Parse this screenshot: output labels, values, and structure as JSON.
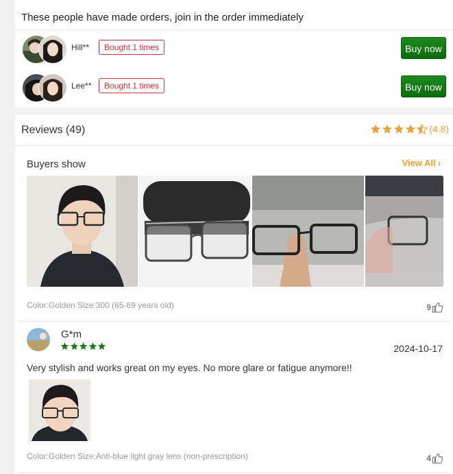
{
  "orders": {
    "title": "These people have made orders, join in the order immediately",
    "buyers": [
      {
        "name": "Hill**",
        "badge": "Bought 1 times",
        "button": "Buy now"
      },
      {
        "name": "Lee**",
        "badge": "Bought 1 times",
        "button": "Buy now"
      }
    ]
  },
  "reviews": {
    "title": "Reviews (49)",
    "rating_value": "(4.8)",
    "rating_stars": 4.5,
    "accent_color": "#e6a23c",
    "buyers_show": {
      "title": "Buyers show",
      "view_all": "View All",
      "meta": "Color:Golden Size:300 (65-69 years old)",
      "likes": "9"
    },
    "items": [
      {
        "user": "G*m",
        "stars": 5,
        "date": "2024-10-17",
        "text": "Very stylish and works great on my eyes. No more glare or fatigue anymore!!",
        "meta": "Color:Golden Size:Anti-blue light gray lens (non-prescription)",
        "likes": "4"
      }
    ]
  },
  "colors": {
    "buy_button": "#168016",
    "badge_red": "#c8333a",
    "review_star_green": "#167a16"
  }
}
